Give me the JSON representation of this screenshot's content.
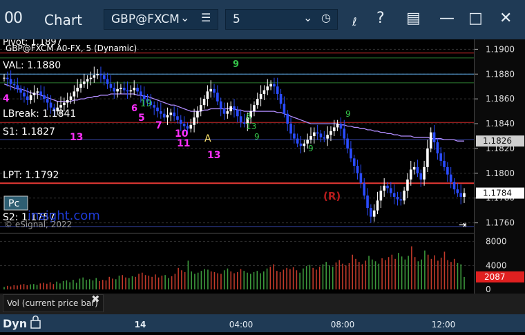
{
  "window": {
    "logo": "00",
    "title": "Chart",
    "symbol": "GBP@FXCM",
    "interval": "5",
    "icons": [
      "link-icon",
      "help-icon",
      "layout-icon",
      "minimize-icon",
      "maximize-icon",
      "close-icon"
    ]
  },
  "overlay": {
    "study_title": "GBP@FXCM A0-FX, 5 (Dynamic)",
    "pivot_label": "Pivot: 1.1897",
    "val_label": "VAL: 1.1880",
    "lbreak_label": "LBreak: 1.1841",
    "s1_label": "S1: 1.1827",
    "lpt_label": "LPT: 1.1792",
    "s2_label": "S2: 1.1757",
    "pc_button": "Pc",
    "watermark": "insight.com",
    "copyright": "© eSignal, 2022",
    "marker_a": "A",
    "marker_r": "(R)",
    "counts": [
      "4",
      "9",
      "19",
      "5",
      "6",
      "7",
      "10",
      "11",
      "13",
      "13",
      "13",
      "9",
      "6",
      "9",
      "9"
    ]
  },
  "chart_data": [
    {
      "type": "bar",
      "title": "GBP@FXCM A0-FX, 5 (Dynamic)",
      "ylim": [
        1.1752,
        1.1908
      ],
      "y_ticks": [
        "1.1900",
        "1.1880",
        "1.1860",
        "1.1840",
        "1.1820",
        "1.1800",
        "1.1780",
        "1.1760"
      ],
      "x_ticks": [
        "14",
        "04:00",
        "08:00",
        "12:00"
      ],
      "current_price": "1.1784",
      "ma_price": "1.1826",
      "levels": [
        {
          "name": "Pivot",
          "value": 1.1897,
          "color": "#c62828"
        },
        {
          "name": "",
          "value": 1.1893,
          "color": "#2e7d32"
        },
        {
          "name": "VAL",
          "value": 1.188,
          "color": "#64b5f6"
        },
        {
          "name": "",
          "value": 1.1873,
          "color": "#2e7d32"
        },
        {
          "name": "LBreak",
          "value": 1.1841,
          "color": "#c62828"
        },
        {
          "name": "S1",
          "value": 1.1827,
          "color": "#3949ab"
        },
        {
          "name": "LPT",
          "value": 1.1792,
          "color": "#e53935"
        },
        {
          "name": "S2",
          "value": 1.1757,
          "color": "#3949ab"
        }
      ],
      "series": [
        {
          "values": [
            1.1877,
            1.1876,
            1.1872,
            1.1871,
            1.1868,
            1.1865,
            1.1862,
            1.1859,
            1.1863,
            1.1865,
            1.1866,
            1.1863,
            1.186,
            1.1857,
            1.1853,
            1.185,
            1.1853,
            1.1855,
            1.1857,
            1.1859,
            1.1862,
            1.1866,
            1.1869,
            1.1872,
            1.1874,
            1.1876,
            1.1877,
            1.1879,
            1.188,
            1.1879,
            1.1876,
            1.1872,
            1.1869,
            1.1866,
            1.1868,
            1.1869,
            1.1867,
            1.1866,
            1.1867,
            1.1869,
            1.1866,
            1.1863,
            1.186,
            1.1858,
            1.1855,
            1.1853,
            1.185,
            1.1848,
            1.1845,
            1.1847,
            1.1849,
            1.1846,
            1.1843,
            1.184,
            1.1838,
            1.1836,
            1.1839,
            1.1845,
            1.185,
            1.1855,
            1.186,
            1.1866,
            1.1868,
            1.1865,
            1.1858,
            1.1852,
            1.1848,
            1.185,
            1.1854,
            1.1851,
            1.1846,
            1.1841,
            1.184,
            1.1845,
            1.185,
            1.1855,
            1.186,
            1.1864,
            1.1867,
            1.187,
            1.1872,
            1.187,
            1.1864,
            1.1856,
            1.1848,
            1.184,
            1.1832,
            1.1828,
            1.1824,
            1.1822,
            1.1824,
            1.1827,
            1.183,
            1.1833,
            1.1832,
            1.1829,
            1.1828,
            1.1831,
            1.1834,
            1.1837,
            1.184,
            1.1836,
            1.1828,
            1.182,
            1.1812,
            1.1806,
            1.18,
            1.1792,
            1.1782,
            1.1772,
            1.1765,
            1.177,
            1.1778,
            1.1786,
            1.179,
            1.1788,
            1.1784,
            1.1781,
            1.1779,
            1.1778,
            1.1786,
            1.1795,
            1.1803,
            1.1805,
            1.18,
            1.1795,
            1.1805,
            1.182,
            1.1833,
            1.1825,
            1.1816,
            1.181,
            1.1805,
            1.1799,
            1.1793,
            1.1787,
            1.1784,
            1.1781,
            1.1784
          ]
        },
        {
          "values": [
            1.1872,
            1.1871,
            1.187,
            1.1869,
            1.1868,
            1.1868,
            1.1867,
            1.1866,
            1.1865,
            1.1864,
            1.1864,
            1.1863,
            1.1862,
            1.1861,
            1.186,
            1.1859,
            1.1858,
            1.1858,
            1.1858,
            1.1858,
            1.1858,
            1.1859,
            1.1859,
            1.186,
            1.186,
            1.1861,
            1.1861,
            1.1862,
            1.1862,
            1.1863,
            1.1863,
            1.1863,
            1.1864,
            1.1864,
            1.1864,
            1.1864,
            1.1864,
            1.1864,
            1.1864,
            1.1864,
            1.1863,
            1.1863,
            1.1862,
            1.1862,
            1.1861,
            1.186,
            1.1859,
            1.1858,
            1.1857,
            1.1856,
            1.1855,
            1.1855,
            1.1854,
            1.1853,
            1.1852,
            1.1851,
            1.185,
            1.185,
            1.185,
            1.185,
            1.1851,
            1.1851,
            1.1852,
            1.1852,
            1.1852,
            1.1852,
            1.1852,
            1.1852,
            1.1852,
            1.1852,
            1.1851,
            1.1851,
            1.185,
            1.185,
            1.185,
            1.185,
            1.185,
            1.185,
            1.185,
            1.185,
            1.185,
            1.185,
            1.1849,
            1.1849,
            1.1848,
            1.1847,
            1.1846,
            1.1845,
            1.1844,
            1.1843,
            1.1842,
            1.1841,
            1.184,
            1.184,
            1.184,
            1.184,
            1.184,
            1.184,
            1.184,
            1.184,
            1.184,
            1.1839,
            1.1839,
            1.1838,
            1.1838,
            1.1837,
            1.1837,
            1.1836,
            1.1836,
            1.1835,
            1.1835,
            1.1834,
            1.1834,
            1.1833,
            1.1833,
            1.1832,
            1.1832,
            1.1831,
            1.1831,
            1.183,
            1.183,
            1.183,
            1.183,
            1.1829,
            1.1829,
            1.1829,
            1.1829,
            1.1829,
            1.1828,
            1.1828,
            1.1828,
            1.1828,
            1.1827,
            1.1827,
            1.1827,
            1.1827,
            1.1826,
            1.1826,
            1.1826
          ]
        }
      ]
    },
    {
      "type": "bar",
      "ylim": [
        0,
        9000
      ],
      "y_ticks": [
        "8000",
        "4000",
        "0"
      ],
      "last_value": "2087",
      "values": [
        400,
        600,
        500,
        700,
        650,
        800,
        900,
        700,
        850,
        900,
        750,
        1000,
        1100,
        950,
        1200,
        900,
        1300,
        1000,
        1400,
        1500,
        1200,
        1600,
        1100,
        1800,
        2000,
        1600,
        1700,
        1500,
        1900,
        1400,
        1600,
        1500,
        2100,
        1800,
        1700,
        2300,
        2400,
        2000,
        1900,
        2200,
        2100,
        2600,
        2800,
        2400,
        2300,
        2100,
        2500,
        2000,
        2300,
        2400,
        1900,
        2200,
        2600,
        3600,
        3200,
        2900,
        4800,
        3000,
        2600,
        2800,
        3100,
        3400,
        3300,
        3000,
        2900,
        2700,
        2600,
        3200,
        3500,
        3000,
        2700,
        2900,
        3400,
        3100,
        2800,
        2600,
        2900,
        3100,
        2700,
        3000,
        3500,
        3800,
        4200,
        3100,
        2900,
        3300,
        3600,
        3400,
        3700,
        3200,
        2800,
        3500,
        3900,
        4100,
        3600,
        3300,
        3800,
        4200,
        4600,
        4000,
        3800,
        4500,
        4900,
        4300,
        4000,
        4400,
        5800,
        5100,
        4600,
        4200,
        4800,
        5600,
        5000,
        4700,
        4300,
        5200,
        4900,
        5400,
        5800,
        5100,
        6100,
        5500,
        5000,
        5600,
        7200,
        5400,
        4700,
        5000,
        6500,
        5800,
        5100,
        5700,
        4800,
        5300,
        6300,
        4900,
        4600,
        5100,
        4400,
        4200,
        2087
      ]
    }
  ]
}
